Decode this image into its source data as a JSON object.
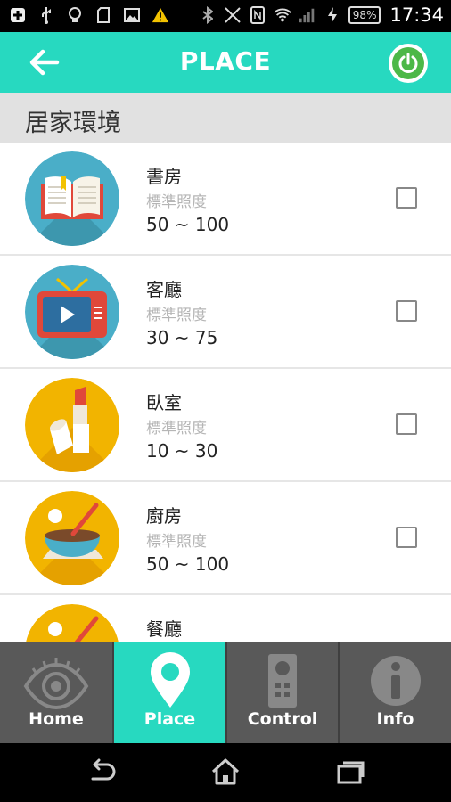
{
  "status_bar": {
    "battery": "98%",
    "time": "17:34",
    "icons": [
      "add-box-icon",
      "usb-icon",
      "bulb-icon",
      "sd-card-icon",
      "image-icon",
      "warning-icon",
      "bluetooth-icon",
      "vibrate-off-icon",
      "nfc-icon",
      "wifi-icon",
      "signal-icon",
      "charging-icon"
    ]
  },
  "app_bar": {
    "title": "PLACE",
    "back_icon": "arrow-left-icon",
    "power_icon": "power-icon"
  },
  "section": {
    "title": "居家環境"
  },
  "places": [
    {
      "name": "書房",
      "sub": "標準照度",
      "range": "50 ~ 100",
      "icon": "book-icon",
      "checked": false
    },
    {
      "name": "客廳",
      "sub": "標準照度",
      "range": "30 ~ 75",
      "icon": "tv-icon",
      "checked": false
    },
    {
      "name": "臥室",
      "sub": "標準照度",
      "range": "10 ~ 30",
      "icon": "cosmetics-icon",
      "checked": false
    },
    {
      "name": "廚房",
      "sub": "標準照度",
      "range": "50 ~ 100",
      "icon": "mixing-bowl-icon",
      "checked": false
    },
    {
      "name": "餐廳",
      "sub": "",
      "range": "",
      "icon": "dining-icon",
      "checked": false
    }
  ],
  "tabs": [
    {
      "label": "Home",
      "icon": "eye-icon",
      "active": false
    },
    {
      "label": "Place",
      "icon": "location-pin-icon",
      "active": true
    },
    {
      "label": "Control",
      "icon": "remote-control-icon",
      "active": false
    },
    {
      "label": "Info",
      "icon": "info-icon",
      "active": false
    }
  ],
  "nav_bar": [
    "back-icon",
    "home-icon",
    "recents-icon"
  ],
  "colors": {
    "accent": "#27d9c0",
    "tab_inactive": "#595959",
    "section_bg": "#e1e1e1",
    "power_green": "#4cb848"
  }
}
